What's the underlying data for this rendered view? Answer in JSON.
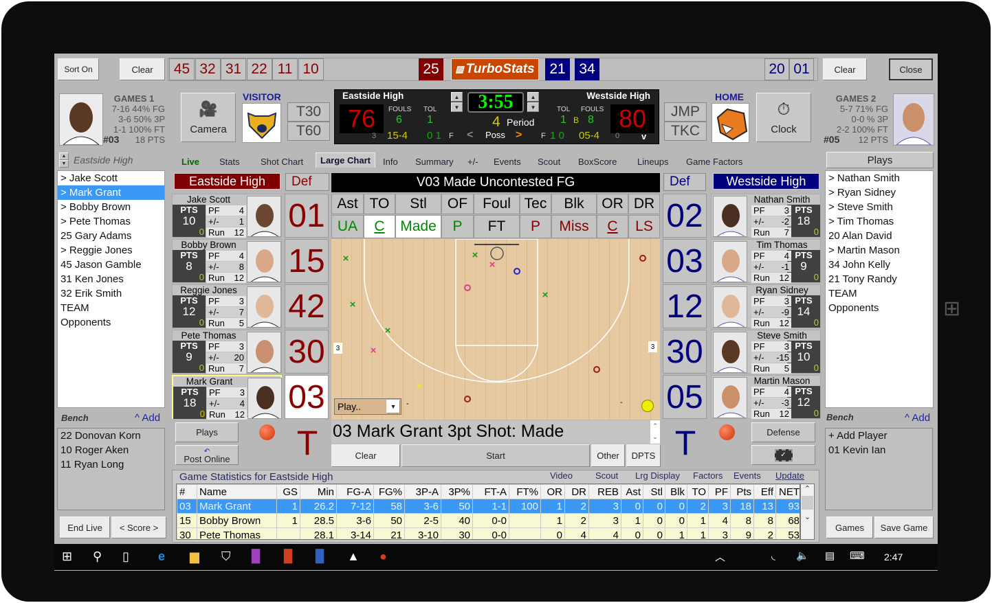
{
  "toolbar": {
    "sort_on": "Sort On",
    "clear_left": "Clear",
    "visitor_numbers": [
      "45",
      "32",
      "31",
      "22",
      "11",
      "10"
    ],
    "visitor_active": "25",
    "logo_text": "TurboStats",
    "home_active": [
      "21",
      "34"
    ],
    "home_numbers": [
      "20",
      "01"
    ],
    "clear_right": "Clear",
    "close": "Close"
  },
  "visitor_player": {
    "games": "GAMES 1",
    "fg": "7-16 44% FG",
    "tp": "3-6 50% 3P",
    "ft": "1-1 100% FT",
    "number": "#03",
    "pts": "18 PTS"
  },
  "camera": "Camera",
  "visitor_label": "VISITOR",
  "timeouts_left": [
    "T30",
    "T60"
  ],
  "scoreboard": {
    "visitor_name": "Eastside High",
    "home_name": "Westside High",
    "visitor_score": "76",
    "home_score": "80",
    "fouls_label": "FOULS",
    "tol_label": "TOL",
    "visitor_fouls": "6",
    "visitor_tol": "1",
    "home_tol": "1",
    "home_bonus": "B",
    "home_fouls": "8",
    "clock": "3:55",
    "period": "4",
    "period_label": "Period",
    "poss_label": "Poss",
    "poss_left": "<",
    "poss_right": ">",
    "visitor_small": "3",
    "visitor_run": "15-4",
    "visitor_f": "0 1",
    "f_label": "F",
    "home_f": "1 0",
    "home_run": "05-4",
    "home_small": "0",
    "v_mark": "v"
  },
  "timeouts_right": [
    "JMP",
    "TKC"
  ],
  "home_label": "HOME",
  "clock_button": "Clock",
  "home_player": {
    "games": "GAMES 2",
    "fg": "5-7 71% FG",
    "tp": "0-0 % 3P",
    "ft": "2-2 100% FT",
    "number": "#05",
    "pts": "12 PTS"
  },
  "roster_header": "Eastside High",
  "tabs": [
    "Live",
    "Stats",
    "Shot Chart",
    "Large Chart",
    "Info",
    "Summary",
    "+/-",
    "Events",
    "Scout",
    "BoxScore",
    "Lineups",
    "Game Factors"
  ],
  "active_tab": "Large Chart",
  "roster": [
    "> Jake Scott",
    "> Mark Grant",
    "> Bobby Brown",
    "> Pete Thomas",
    "25 Gary Adams",
    "> Reggie Jones",
    "45 Jason Gamble",
    "31 Ken Jones",
    "32 Erik Smith",
    "TEAM",
    "Opponents"
  ],
  "roster_selected": "> Mark Grant",
  "bench_label": "Bench",
  "add_label": "^ Add",
  "bench": [
    "22 Donovan Korn",
    "10 Roger Aken",
    "11 Ryan Long"
  ],
  "end_live": "End Live",
  "score_btn": "< Score >",
  "visitor_team": {
    "name": "Eastside High",
    "def": "Def",
    "players": [
      {
        "name": "Jake Scott",
        "pts": "10",
        "pf": "4",
        "pm": "1",
        "run": "12",
        "zero": "0",
        "num": "01"
      },
      {
        "name": "Bobby Brown",
        "pts": "8",
        "pf": "4",
        "pm": "8",
        "run": "12",
        "zero": "0",
        "num": "15"
      },
      {
        "name": "Reggie Jones",
        "pts": "12",
        "pf": "3",
        "pm": "7",
        "run": "5",
        "zero": "0",
        "num": "42"
      },
      {
        "name": "Pete Thomas",
        "pts": "9",
        "pf": "3",
        "pm": "20",
        "run": "7",
        "zero": "0",
        "num": "30"
      },
      {
        "name": "Mark Grant",
        "pts": "18",
        "pf": "3",
        "pm": "4",
        "run": "12",
        "zero": "0",
        "num": "03"
      }
    ]
  },
  "home_team": {
    "name": "Westside High",
    "def": "Def",
    "players": [
      {
        "name": "Nathan Smith",
        "pts": "18",
        "pf": "3",
        "pm": "-2",
        "run": "7",
        "zero": "0",
        "num": "02"
      },
      {
        "name": "Tim Thomas",
        "pts": "9",
        "pf": "4",
        "pm": "-1",
        "run": "12",
        "zero": "0",
        "num": "03"
      },
      {
        "name": "Ryan Sidney",
        "pts": "14",
        "pf": "3",
        "pm": "-9",
        "run": "12",
        "zero": "0",
        "num": "12"
      },
      {
        "name": "Steve Smith",
        "pts": "10",
        "pf": "3",
        "pm": "-15",
        "run": "5",
        "zero": "0",
        "num": "30"
      },
      {
        "name": "Martin Mason",
        "pts": "12",
        "pf": "4",
        "pm": "-3",
        "run": "12",
        "zero": "0",
        "num": "05"
      }
    ]
  },
  "stat_labels": {
    "pts": "PTS",
    "pf": "PF",
    "pm": "+/-",
    "run": "Run"
  },
  "play_title": "V03 Made Uncontested FG",
  "actions": [
    "Ast",
    "TO",
    "Stl",
    "OF",
    "Foul",
    "Tec",
    "Blk",
    "OR",
    "DR"
  ],
  "results": [
    "UA",
    "C",
    "Made",
    "P",
    "FT",
    "P",
    "Miss",
    "C",
    "LS"
  ],
  "court": {
    "left_count": "3",
    "right_count": "3",
    "play_select": "Play..",
    "dash": "-"
  },
  "play_text": "03 Mark Grant  3pt Shot: Made",
  "center_buttons": {
    "clear": "Clear",
    "start": "Start",
    "other": "Other",
    "dpts": "DPTS"
  },
  "timeout_letter": "T",
  "plays_btn": "Plays",
  "post_online": "Post Online",
  "defense": "Defense",
  "plays_header": "Plays",
  "plays_list": [
    "> Nathan Smith",
    "> Ryan Sidney",
    "> Steve Smith",
    "> Tim Thomas",
    "20 Alan David",
    "> Martin Mason",
    "34 John Kelly",
    "21 Tony Randy",
    "TEAM",
    "Opponents"
  ],
  "home_bench": [
    "+ Add Player",
    "01 Kevin Ian"
  ],
  "games_btn": "Games",
  "save_game": "Save Game",
  "stats": {
    "title": "Game Statistics for Eastside High",
    "links": [
      "Video",
      "Scout",
      "Lrg Display",
      "Factors",
      "Events",
      "Update"
    ],
    "columns": [
      "#",
      "Name",
      "GS",
      "Min",
      "FG-A",
      "FG%",
      "3P-A",
      "3P%",
      "FT-A",
      "FT%",
      "OR",
      "DR",
      "REB",
      "Ast",
      "Stl",
      "Blk",
      "TO",
      "PF",
      "Pts",
      "Eff",
      "NET"
    ],
    "rows": [
      [
        "03",
        "Mark Grant",
        "1",
        "26.2",
        "7-12",
        "58",
        "3-6",
        "50",
        "1-1",
        "100",
        "1",
        "2",
        "3",
        "0",
        "0",
        "0",
        "2",
        "3",
        "18",
        "13",
        "93"
      ],
      [
        "15",
        "Bobby Brown",
        "1",
        "28.5",
        "3-6",
        "50",
        "2-5",
        "40",
        "0-0",
        "",
        "1",
        "2",
        "3",
        "1",
        "0",
        "0",
        "1",
        "4",
        "8",
        "8",
        "68"
      ],
      [
        "30",
        "Pete Thomas",
        "",
        "28.1",
        "3-14",
        "21",
        "3-10",
        "30",
        "0-0",
        "",
        "0",
        "4",
        "4",
        "0",
        "0",
        "1",
        "1",
        "3",
        "9",
        "2",
        "53"
      ]
    ]
  },
  "taskbar": {
    "time": "2:47"
  },
  "colors": {
    "visitor": "#8b0000",
    "home": "#00007f",
    "logo": "#c84600",
    "highlight": "#3b99f5"
  }
}
